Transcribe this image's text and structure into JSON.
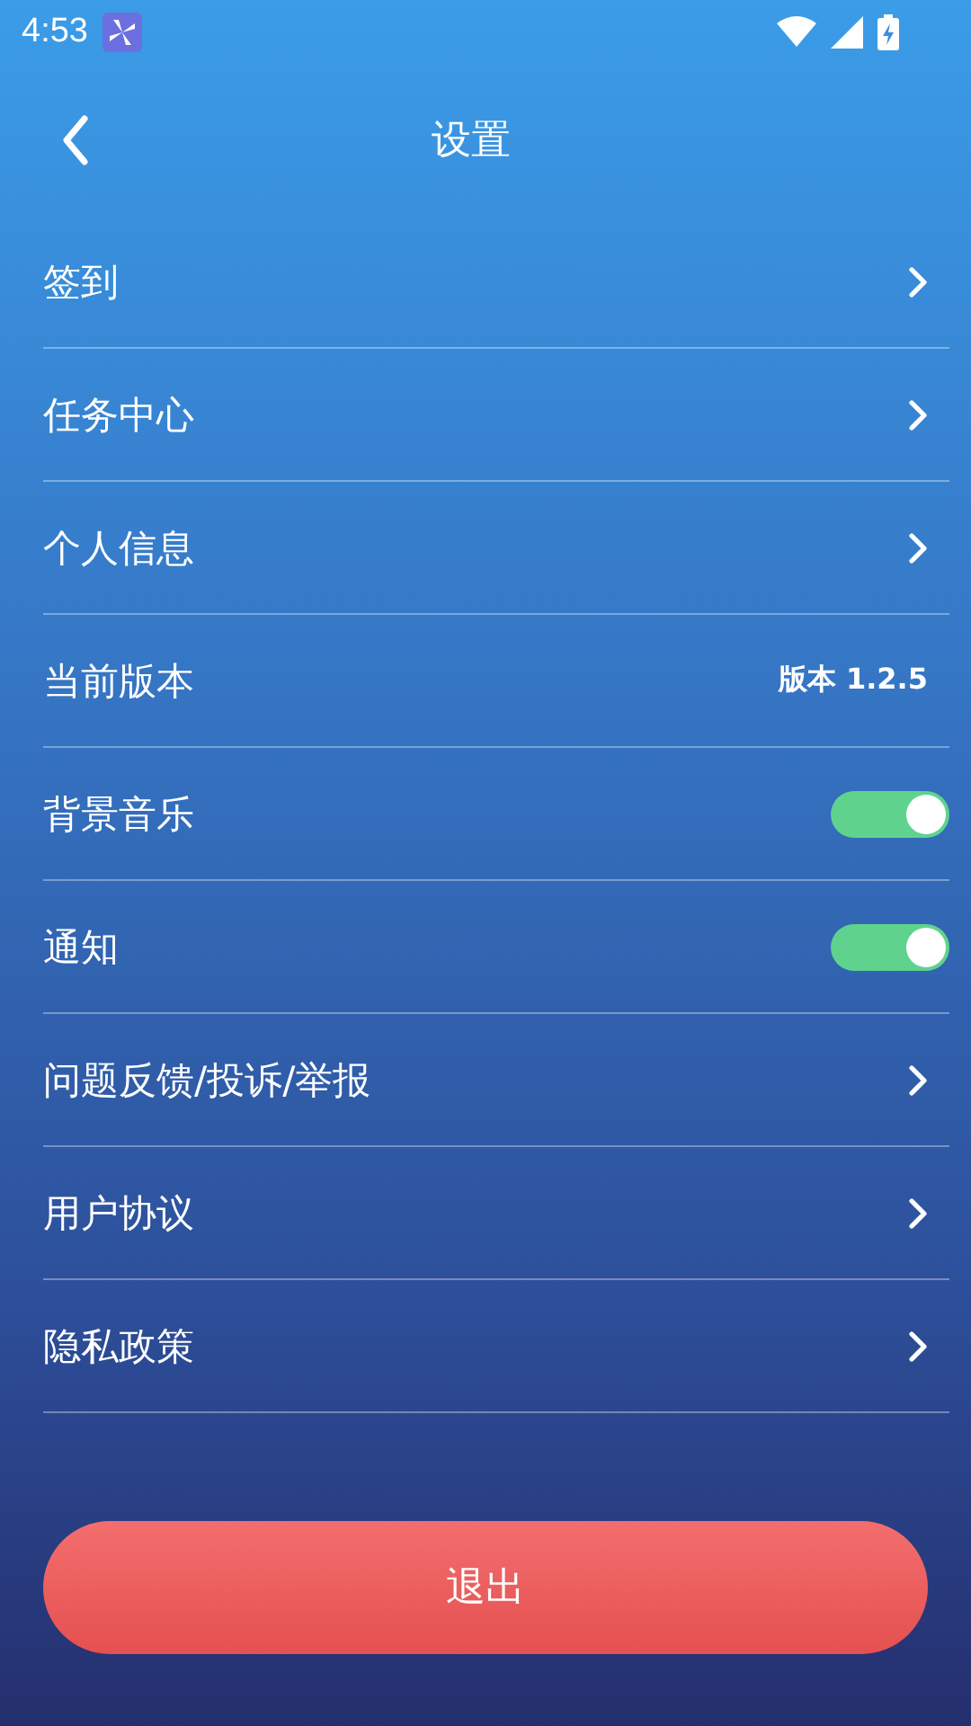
{
  "status_bar": {
    "time": "4:53"
  },
  "header": {
    "title": "设置"
  },
  "items": [
    {
      "kind": "link",
      "label": "签到"
    },
    {
      "kind": "link",
      "label": "任务中心"
    },
    {
      "kind": "link",
      "label": "个人信息"
    },
    {
      "kind": "value",
      "label": "当前版本",
      "value": "版本 1.2.5"
    },
    {
      "kind": "toggle",
      "label": "背景音乐",
      "on": true
    },
    {
      "kind": "toggle",
      "label": "通知",
      "on": true
    },
    {
      "kind": "link",
      "label": "问题反馈/投诉/举报"
    },
    {
      "kind": "link",
      "label": "用户协议"
    },
    {
      "kind": "link",
      "label": "隐私政策"
    }
  ],
  "logout_button": {
    "label": "退出"
  }
}
